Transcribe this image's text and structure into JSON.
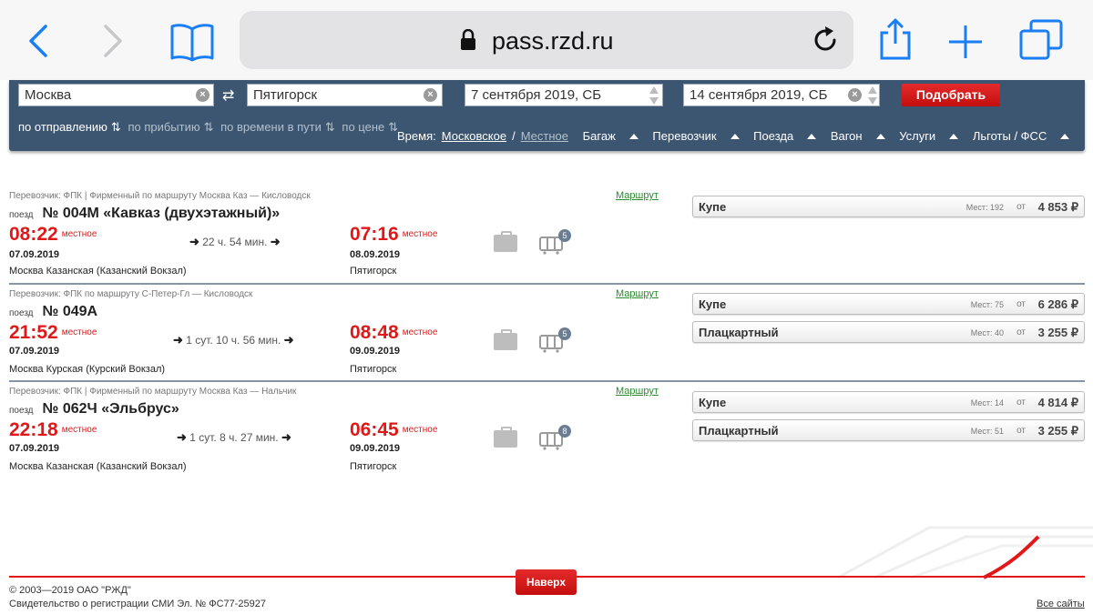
{
  "browser": {
    "url": "pass.rzd.ru"
  },
  "search": {
    "from": "Москва",
    "to": "Пятигорск",
    "date_there": "7 сентября 2019, СБ",
    "date_back": "14 сентября 2019, СБ",
    "find_label": "Подобрать",
    "sort": [
      "по отправлению",
      "по прибытию",
      "по времени в пути",
      "по цене"
    ],
    "time_label": "Время:",
    "time_moscow": "Московское",
    "time_sep": "/",
    "time_local": "Местное",
    "filters": [
      "Багаж",
      "Перевозчик",
      "Поезда",
      "Вагон",
      "Услуги"
    ],
    "benefits": "Льготы / ФСС"
  },
  "trains": [
    {
      "carrier": "Перевозчик: ФПК | Фирменный    по маршруту Москва Каз — Кисловодск",
      "route_link": "Маршрут",
      "train_label": "поезд",
      "number": "№ 004М «Кавказ (двухэтажный)»",
      "dep_time": "08:22",
      "dep_note": "местное",
      "dep_date": "07.09.2019",
      "dep_station": "Москва Казанская (Казанский Вокзал)",
      "duration": "22 ч. 54 мин.",
      "arr_time": "07:16",
      "arr_note": "местное",
      "arr_date": "08.09.2019",
      "arr_station": "Пятигорск",
      "wagons": "5",
      "seats": [
        {
          "class": "Купе",
          "count": "Мест: 192",
          "from": "от",
          "price": "4 853 ₽"
        }
      ]
    },
    {
      "carrier": "Перевозчик: ФПК    по маршруту С-Петер-Гл — Кисловодск",
      "route_link": "Маршрут",
      "train_label": "поезд",
      "number": "№ 049А",
      "dep_time": "21:52",
      "dep_note": "местное",
      "dep_date": "07.09.2019",
      "dep_station": "Москва Курская (Курский Вокзал)",
      "duration": "1 сут. 10 ч. 56 мин.",
      "arr_time": "08:48",
      "arr_note": "местное",
      "arr_date": "09.09.2019",
      "arr_station": "Пятигорск",
      "wagons": "5",
      "seats": [
        {
          "class": "Купе",
          "count": "Мест: 75",
          "from": "от",
          "price": "6 286 ₽"
        },
        {
          "class": "Плацкартный",
          "count": "Мест: 40",
          "from": "от",
          "price": "3 255 ₽"
        }
      ]
    },
    {
      "carrier": "Перевозчик: ФПК | Фирменный    по маршруту Москва Каз — Нальчик",
      "route_link": "Маршрут",
      "train_label": "поезд",
      "number": "№ 062Ч «Эльбрус»",
      "dep_time": "22:18",
      "dep_note": "местное",
      "dep_date": "07.09.2019",
      "dep_station": "Москва Казанская (Казанский Вокзал)",
      "duration": "1 сут. 8 ч. 27 мин.",
      "arr_time": "06:45",
      "arr_note": "местное",
      "arr_date": "09.09.2019",
      "arr_station": "Пятигорск",
      "wagons": "8",
      "seats": [
        {
          "class": "Купе",
          "count": "Мест: 14",
          "from": "от",
          "price": "4 814 ₽"
        },
        {
          "class": "Плацкартный",
          "count": "Мест: 51",
          "from": "от",
          "price": "3 255 ₽"
        }
      ]
    }
  ],
  "footer": {
    "up_label": "Наверх",
    "copyright": "© 2003—2019  ОАО \"РЖД\"",
    "registration": "Свидетельство о регистрации СМИ Эл. № ФС77-25927",
    "all_sites": "Все сайты"
  },
  "colors": {
    "panel": "#3c5570",
    "accent_red": "#e01818",
    "route_green": "#2c8a30",
    "browser_blue": "#1a7ef5"
  }
}
